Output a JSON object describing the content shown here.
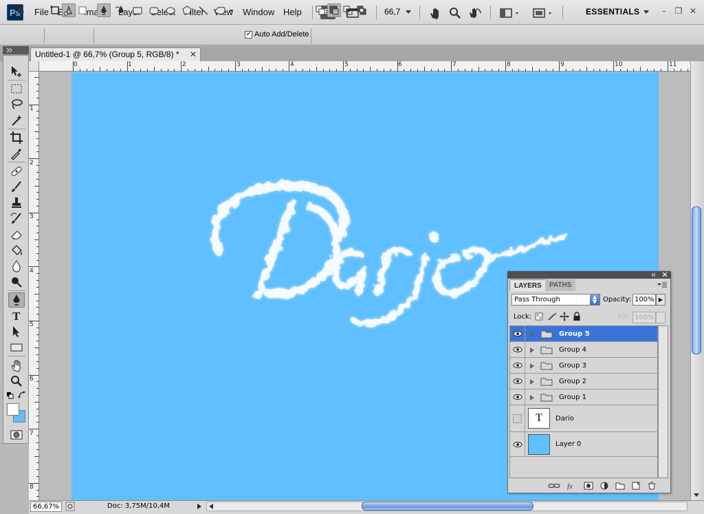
{
  "app": {
    "logo": "Ps"
  },
  "menu": [
    "File",
    "Edit",
    "Image",
    "Layer",
    "Select",
    "Filter",
    "View",
    "Window",
    "Help"
  ],
  "appbar": {
    "bridge_label": "Br",
    "zoom_value": "66,7",
    "workspace": "ESSENTIALS"
  },
  "options": {
    "auto_add_delete": "Auto Add/Delete",
    "auto_add_checked": true
  },
  "document": {
    "tab_title": "Untitled-1 @ 66,7% (Group 5, RGB/8) *"
  },
  "ruler": {
    "h_labels": [
      "0",
      "1",
      "2",
      "3",
      "4",
      "5",
      "6",
      "7",
      "8",
      "9",
      "10",
      "11"
    ],
    "v_labels": [
      "1",
      "2",
      "3",
      "4",
      "5",
      "6",
      "7",
      "8"
    ]
  },
  "canvas": {
    "background": "#5fbfff",
    "text": "Dario"
  },
  "status": {
    "zoom": "66,67%",
    "doc_size": "Doc: 3,75M/10,4M"
  },
  "layers_panel": {
    "tabs": [
      "LAYERS",
      "PATHS"
    ],
    "blend_mode": "Pass Through",
    "opacity_label": "Opacity:",
    "opacity": "100%",
    "lock_label": "Lock:",
    "fill_label": "Fill:",
    "fill": "100%",
    "layers": [
      {
        "name": "Group 5",
        "type": "group",
        "visible": true,
        "selected": true
      },
      {
        "name": "Group 4",
        "type": "group",
        "visible": true,
        "selected": false
      },
      {
        "name": "Group 3",
        "type": "group",
        "visible": true,
        "selected": false
      },
      {
        "name": "Group 2",
        "type": "group",
        "visible": true,
        "selected": false
      },
      {
        "name": "Group 1",
        "type": "group",
        "visible": true,
        "selected": false
      },
      {
        "name": "Dario",
        "type": "text",
        "visible": false,
        "selected": false,
        "thumb_glyph": "T"
      },
      {
        "name": "Layer 0",
        "type": "layer",
        "visible": true,
        "selected": false,
        "thumb_color": "#5fbfff"
      }
    ]
  },
  "colors": {
    "accent": "#3a74d8",
    "canvas": "#5fbfff",
    "foreground": "#ffffff",
    "background_swatch": "#5fbfff"
  }
}
